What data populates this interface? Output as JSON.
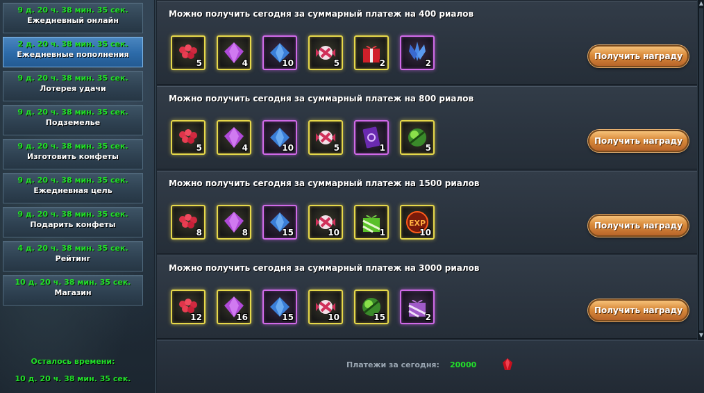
{
  "sidebar": {
    "items": [
      {
        "timer": "9 д. 20 ч. 38 мин. 35 сек.",
        "label": "Ежедневный онлайн"
      },
      {
        "timer": "2 д. 20 ч. 38 мин. 35 сек.",
        "label": "Ежедневные пополнения"
      },
      {
        "timer": "9 д. 20 ч. 38 мин. 35 сек.",
        "label": "Лотерея удачи"
      },
      {
        "timer": "9 д. 20 ч. 38 мин. 35 сек.",
        "label": "Подземелье"
      },
      {
        "timer": "9 д. 20 ч. 38 мин. 35 сек.",
        "label": "Изготовить конфеты"
      },
      {
        "timer": "9 д. 20 ч. 38 мин. 35 сек.",
        "label": "Ежедневная цель"
      },
      {
        "timer": "9 д. 20 ч. 38 мин. 35 сек.",
        "label": "Подарить конфеты"
      },
      {
        "timer": "4 д. 20 ч. 38 мин. 35 сек.",
        "label": "Рейтинг"
      },
      {
        "timer": "10 д. 20 ч. 38 мин. 35 сек.",
        "label": "Магазин"
      }
    ],
    "active_index": 1,
    "remaining_label": "Осталось времени:",
    "remaining_value": "10 д. 20 ч. 38 мин. 35 сек."
  },
  "rewards": [
    {
      "title": "Можно получить сегодня за суммарный платеж на 400 риалов",
      "button": "Получить награду",
      "items": [
        {
          "icon": "red-candies-icon",
          "qty": "5",
          "frame": "gold"
        },
        {
          "icon": "purple-crystal-icon",
          "qty": "4",
          "frame": "gold"
        },
        {
          "icon": "blue-crystal-icon",
          "qty": "10",
          "frame": "purple"
        },
        {
          "icon": "striped-candy-icon",
          "qty": "5",
          "frame": "gold"
        },
        {
          "icon": "red-gift-box-icon",
          "qty": "2",
          "frame": "gold"
        },
        {
          "icon": "blue-flower-icon",
          "qty": "2",
          "frame": "purple"
        }
      ]
    },
    {
      "title": "Можно получить сегодня за суммарный платеж на 800 риалов",
      "button": "Получить награду",
      "items": [
        {
          "icon": "red-candies-icon",
          "qty": "5",
          "frame": "gold"
        },
        {
          "icon": "purple-crystal-icon",
          "qty": "4",
          "frame": "gold"
        },
        {
          "icon": "blue-crystal-icon",
          "qty": "10",
          "frame": "purple"
        },
        {
          "icon": "striped-candy-icon",
          "qty": "5",
          "frame": "gold"
        },
        {
          "icon": "purple-card-icon",
          "qty": "1",
          "frame": "purple"
        },
        {
          "icon": "green-orb-icon",
          "qty": "5",
          "frame": "gold"
        }
      ]
    },
    {
      "title": "Можно получить сегодня за суммарный платеж на 1500 риалов",
      "button": "Получить награду",
      "items": [
        {
          "icon": "red-candies-icon",
          "qty": "8",
          "frame": "gold"
        },
        {
          "icon": "purple-crystal-icon",
          "qty": "8",
          "frame": "gold"
        },
        {
          "icon": "blue-crystal-icon",
          "qty": "15",
          "frame": "purple"
        },
        {
          "icon": "striped-candy-icon",
          "qty": "10",
          "frame": "gold"
        },
        {
          "icon": "green-gift-box-icon",
          "qty": "1",
          "frame": "gold"
        },
        {
          "icon": "exp-orb-icon",
          "qty": "10",
          "frame": "gold",
          "text": "EXP"
        }
      ]
    },
    {
      "title": "Можно получить сегодня за суммарный платеж на 3000 риалов",
      "button": "Получить награду",
      "items": [
        {
          "icon": "red-candies-icon",
          "qty": "12",
          "frame": "gold"
        },
        {
          "icon": "purple-crystal-icon",
          "qty": "16",
          "frame": "gold"
        },
        {
          "icon": "blue-crystal-icon",
          "qty": "15",
          "frame": "purple"
        },
        {
          "icon": "striped-candy-icon",
          "qty": "10",
          "frame": "gold"
        },
        {
          "icon": "green-orb-icon",
          "qty": "15",
          "frame": "gold"
        },
        {
          "icon": "purple-gift-box-icon",
          "qty": "2",
          "frame": "purple"
        }
      ]
    }
  ],
  "footer": {
    "payments_label": "Платежи за сегодня:",
    "payments_value": "20000",
    "currency_icon": "ruby-icon"
  },
  "colors": {
    "timer": "#22e02a",
    "active_tab": "#2c6aa8",
    "gold_frame": "#e6d84a",
    "purple_frame": "#d06ae8",
    "button": "#d98a3a"
  }
}
